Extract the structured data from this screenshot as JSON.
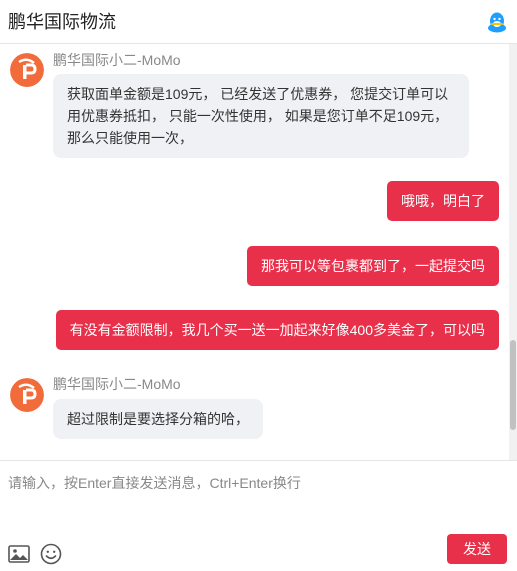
{
  "header": {
    "title": "鹏华国际物流",
    "qq_icon": "qq-penguin-icon",
    "accent": "#1e9fff"
  },
  "colors": {
    "brand": "#e8304a",
    "incoming_bubble": "#f0f1f4"
  },
  "messages": [
    {
      "direction": "in",
      "sender": "鹏华国际小二-MoMo",
      "lines": [
        "获取面单金额是109元，  已经发送了优惠券，  您提交订单可以",
        "用优惠券抵扣，  只能一次性使用，  如果是您订单不足109元，",
        "那么只能使用一次，"
      ]
    },
    {
      "direction": "out",
      "text": "哦哦，明白了"
    },
    {
      "direction": "out",
      "text": "那我可以等包裹都到了，一起提交吗"
    },
    {
      "direction": "out",
      "text": "有没有金额限制，我几个买一送一加起来好像400多美金了，可以吗"
    },
    {
      "direction": "in",
      "sender": "鹏华国际小二-MoMo",
      "lines": [
        "超过限制是要选择分箱的哈，"
      ]
    }
  ],
  "composer": {
    "placeholder": "请输入，按Enter直接发送消息，Ctrl+Enter换行",
    "value": "",
    "image_icon": "image-icon",
    "emoji_icon": "emoji-icon",
    "send_label": "发送"
  }
}
